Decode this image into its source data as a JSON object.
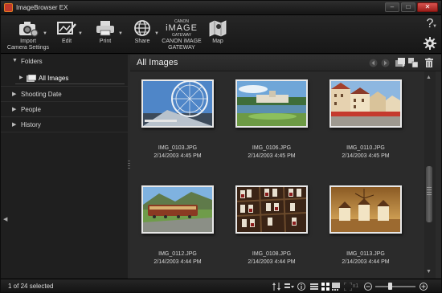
{
  "window": {
    "title": "ImageBrowser EX",
    "minimize": "–",
    "maximize": "□",
    "close": "✕"
  },
  "toolbar": {
    "import": {
      "label": "Import\nCamera Settings",
      "icon": "camera-gear-icon"
    },
    "edit": {
      "label": "Edit",
      "icon": "edit-pencil-icon"
    },
    "print": {
      "label": "Print",
      "icon": "printer-icon"
    },
    "share": {
      "label": "Share",
      "icon": "globe-icon"
    },
    "gateway": {
      "brand": "CANON",
      "logo": "iMAGE",
      "sub": "GATEWAY",
      "label": "CANON iMAGE\nGATEWAY"
    },
    "map": {
      "label": "Map",
      "icon": "map-icon"
    },
    "help": "?",
    "settings_icon": "gear-icon"
  },
  "sidebar": {
    "folders": "Folders",
    "all_images": "All Images",
    "shooting_date": "Shooting Date",
    "people": "People",
    "history": "History"
  },
  "main": {
    "title": "All Images",
    "images": [
      {
        "name": "IMG_0103.JPG",
        "date": "2/14/2003 4:45 PM",
        "scene": "ferris"
      },
      {
        "name": "IMG_0106.JPG",
        "date": "2/14/2003 4:45 PM",
        "scene": "palace"
      },
      {
        "name": "IMG_0110.JPG",
        "date": "2/14/2003 4:45 PM",
        "scene": "street"
      },
      {
        "name": "IMG_0112.JPG",
        "date": "2/14/2003 4:44 PM",
        "scene": "train"
      },
      {
        "name": "IMG_0108.JPG",
        "date": "2/14/2003 4:44 PM",
        "scene": "wine"
      },
      {
        "name": "IMG_0113.JPG",
        "date": "2/14/2003 4:44 PM",
        "scene": "windmills"
      }
    ]
  },
  "status": {
    "selection": "1 of 24 selected",
    "zoom_level": 0.35,
    "ratio_label": "x1"
  }
}
